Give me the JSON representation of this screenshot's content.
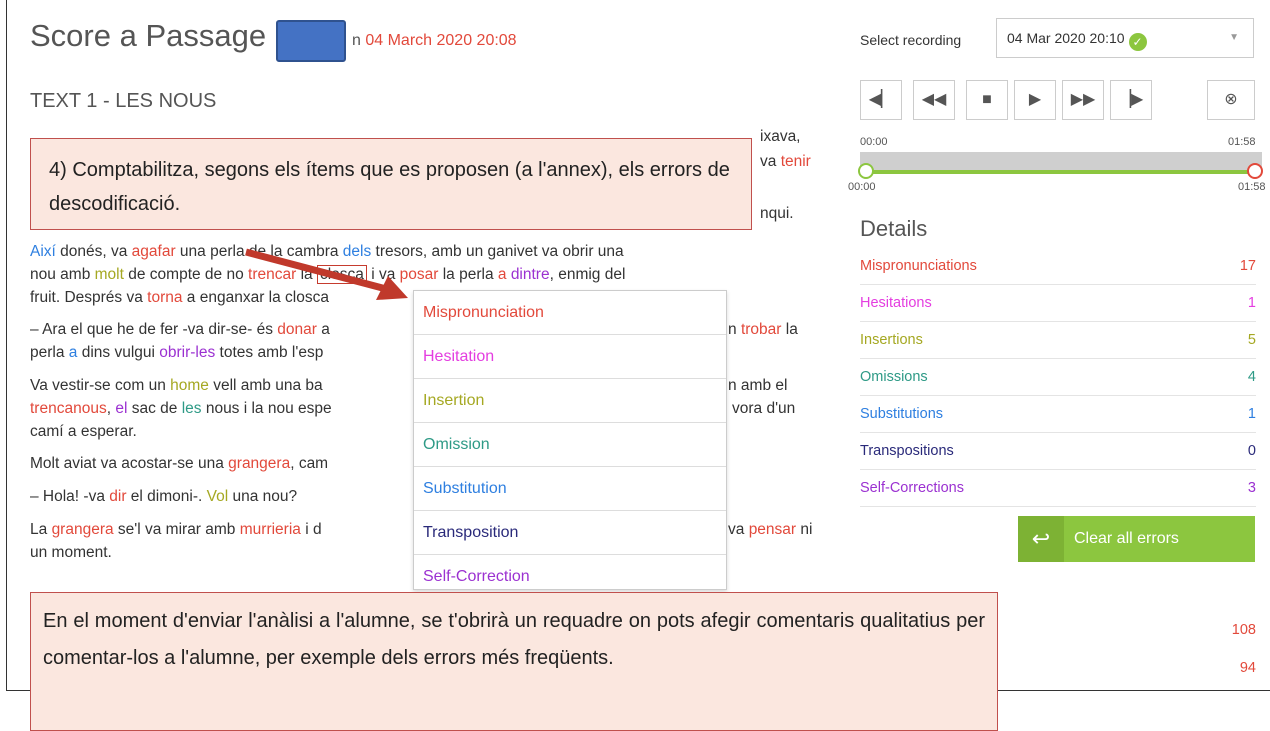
{
  "header": {
    "title": "Score a Passage",
    "date_prefix": "n",
    "date": "04 March 2020 20:08"
  },
  "passage": {
    "title": "TEXT 1 - LES NOUS",
    "line1_end": "ixava,",
    "line2_end": "va",
    "line2_word": "tenir",
    "line3_end": "nqui.",
    "line4": {
      "w1": "Així",
      "t1": " donés, va ",
      "w2": "agafar",
      "t2": " una perla de la cambra ",
      "w3": "dels",
      "t3": " tresors, amb un ganivet va obrir una"
    },
    "line5": {
      "t1": "nou amb ",
      "w1": "molt",
      "t2": " de compte de no ",
      "w2": "trencar",
      "t3": " la ",
      "boxed": "closca",
      "t4": " i va ",
      "w3": "posar",
      "t5": " la perla ",
      "w4": "a",
      "t6": " ",
      "w5": "dintre",
      "t7": ", enmig del"
    },
    "line6": {
      "t1": "fruit. Després va ",
      "w1": "torna",
      "t2": " a enganxar la closca"
    },
    "line7": {
      "t1": "– Ara el que he de fer -va dir-se- és ",
      "w1": "donar",
      "t2": " a",
      "end_pre": "n ",
      "end_w": "trobar",
      "end_t": " la"
    },
    "line8": {
      "t1": "perla ",
      "w1": "a",
      "t2": " dins vulgui ",
      "w2": "obrir-les",
      "t3": " totes amb l'esp"
    },
    "line9": {
      "t1": "Va vestir-se com un ",
      "w1": "home",
      "t2": " vell amb una ba",
      "end": "n amb el"
    },
    "line10": {
      "w1": "trencanous",
      "t1": ", ",
      "w2": "el",
      "t2": " sac de ",
      "w3": "les",
      "t3": " nous i la nou espe",
      "end": "vora d'un"
    },
    "line11": "camí a esperar.",
    "line12": {
      "t1": "Molt aviat va acostar-se una ",
      "w1": "grangera",
      "t2": ", cam"
    },
    "line13": {
      "t1": "– Hola! -va ",
      "w1": "dir",
      "t2": " el dimoni-. ",
      "w2": "Vol",
      "t3": " una nou?"
    },
    "line14": {
      "t1": "La ",
      "w1": "grangera",
      "t2": " se'l va mirar amb ",
      "w2": "murrieria",
      "t3": " i d",
      "end_pre": "va ",
      "end_w": "pensar",
      "end_t": " ni"
    },
    "line15": "un moment."
  },
  "context_menu": {
    "items": [
      "Mispronunciation",
      "Hesitation",
      "Insertion",
      "Omission",
      "Substitution",
      "Transposition",
      "Self-Correction"
    ]
  },
  "recording": {
    "label": "Select recording",
    "selected": "04 Mar 2020 20:10"
  },
  "player": {
    "icons": [
      "skip-back-icon",
      "rewind-icon",
      "stop-icon",
      "play-icon",
      "fast-forward-icon",
      "skip-forward-icon",
      "close-icon"
    ],
    "start_top": "00:00",
    "end_top": "01:58",
    "start_bottom": "00:00",
    "end_bottom": "01:58"
  },
  "details": {
    "heading": "Details",
    "rows": [
      {
        "label": "Mispronunciations",
        "count": "17"
      },
      {
        "label": "Hesitations",
        "count": "1"
      },
      {
        "label": "Insertions",
        "count": "5"
      },
      {
        "label": "Omissions",
        "count": "4"
      },
      {
        "label": "Substitutions",
        "count": "1"
      },
      {
        "label": "Transpositions",
        "count": "0"
      },
      {
        "label": "Self-Corrections",
        "count": "3"
      }
    ],
    "clear_label": "Clear all errors"
  },
  "stats": {
    "a": "108",
    "b": "94"
  },
  "callouts": {
    "top": "4) Comptabilitza, segons els ítems que es proposen (a l'annex), els errors de descodificació.",
    "bottom": "En el moment d'enviar l'anàlisi a l'alumne, se t'obrirà un requadre on pots afegir comentaris qualitatius per comentar-los a l'alumne, per exemple dels errors més freqüents."
  },
  "colors": {
    "mispronunciation": "#e2493b",
    "hesitation": "#e43ee0",
    "insertion": "#a5a822",
    "omission": "#2e9a86",
    "substitution": "#2e7fe0",
    "transposition": "#2a2a7a",
    "self_correction": "#9b31d1",
    "accent_green": "#8cc63f"
  }
}
